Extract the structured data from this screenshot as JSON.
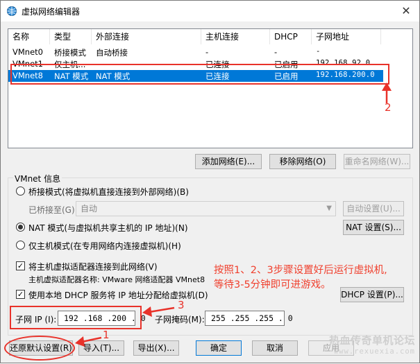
{
  "window": {
    "title": "虚拟网络编辑器",
    "close_glyph": "✕"
  },
  "table": {
    "headers": [
      "名称",
      "类型",
      "外部连接",
      "主机连接",
      "DHCP",
      "子网地址"
    ],
    "rows": [
      {
        "name": "VMnet0",
        "type": "桥接模式",
        "external": "自动桥接",
        "host": "-",
        "dhcp": "-",
        "subnet": "-",
        "selected": false
      },
      {
        "name": "VMnet1",
        "type": "仅主机...",
        "external": "-",
        "host": "已连接",
        "dhcp": "已启用",
        "subnet": "192.168.92.0",
        "selected": false
      },
      {
        "name": "VMnet8",
        "type": "NAT 模式",
        "external": "NAT 模式",
        "host": "已连接",
        "dhcp": "已启用",
        "subnet": "192.168.200.0",
        "selected": true
      }
    ]
  },
  "list_buttons": {
    "add": "添加网络(E)...",
    "remove": "移除网络(O)",
    "rename": "重命名网络(W)..."
  },
  "vmnet_info": {
    "group_label": "VMnet 信息",
    "bridge_radio": "桥接模式(将虚拟机直接连接到外部网络)(B)",
    "bridge_to_label": "已桥接至(G):",
    "bridge_to_value": "自动",
    "auto_settings": "自动设置(U)...",
    "nat_radio": "NAT 模式(与虚拟机共享主机的 IP 地址)(N)",
    "nat_settings": "NAT 设置(S)...",
    "host_only_radio": "仅主机模式(在专用网络内连接虚拟机)(H)",
    "connect_adapter": "将主机虚拟适配器连接到此网络(V)",
    "adapter_name_label": "主机虚拟适配器名称: VMware 网络适配器 VMnet8",
    "use_dhcp": "使用本地 DHCP 服务将 IP 地址分配给虚拟机(D)",
    "dhcp_settings": "DHCP 设置(P)...",
    "subnet_ip_label": "子网 IP (I):",
    "subnet_ip_value": "192 .168 .200 . 0",
    "subnet_mask_label": "子网掩码(M):",
    "subnet_mask_value": "255 .255 .255 . 0",
    "selected_mode": "nat",
    "connect_adapter_checked": true,
    "use_dhcp_checked": true
  },
  "bottom_buttons": {
    "restore": "还原默认设置(R)",
    "import": "导入(T)...",
    "export": "导出(X)...",
    "ok": "确定",
    "cancel": "取消",
    "apply": "应用"
  },
  "annotations": {
    "note_line1": "按照1、2、3步骤设置好后运行虚拟机,",
    "note_line2": "等待3-5分钟即可进游戏。",
    "step1": "1",
    "step2": "2",
    "step3": "3",
    "color": "#e8322a"
  },
  "watermark": {
    "line1": "热血传奇单机论坛",
    "line2": "www.rexuexia.com"
  }
}
